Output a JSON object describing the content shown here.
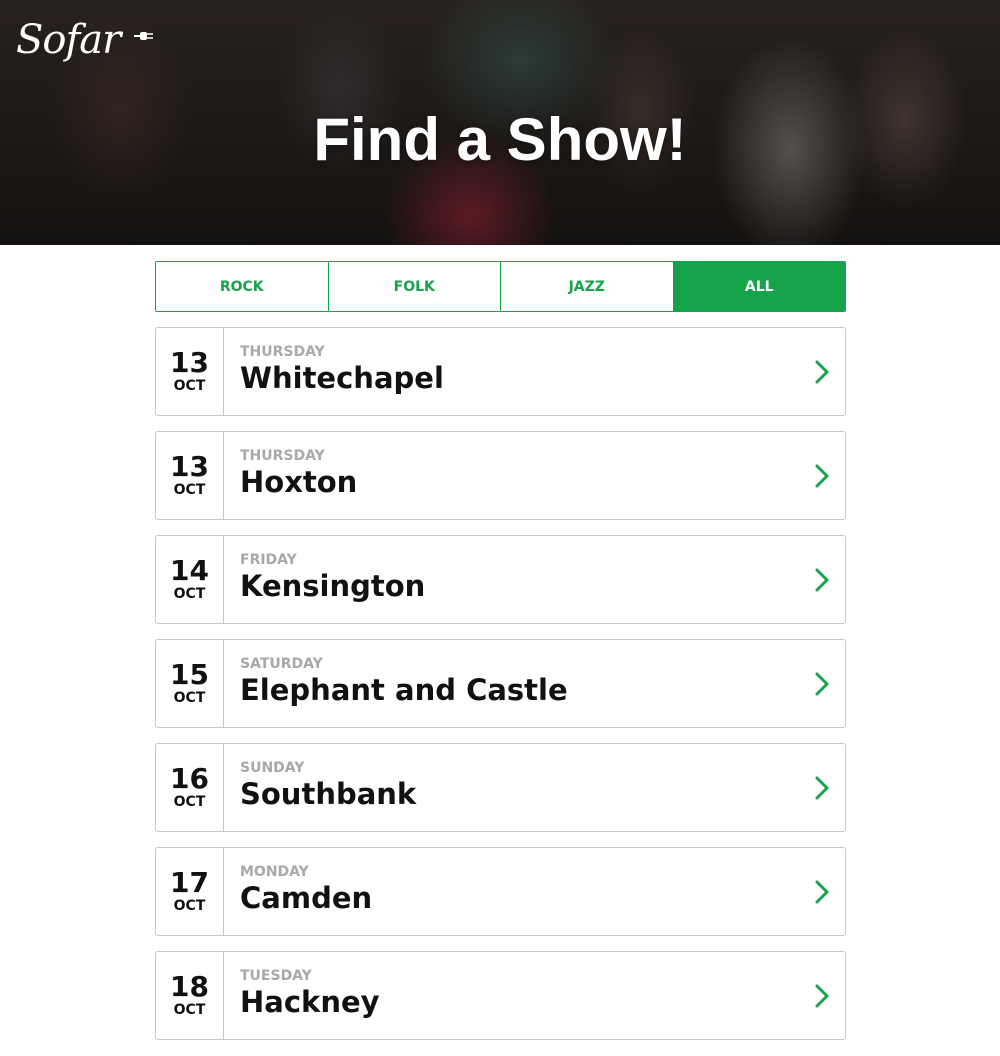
{
  "header": {
    "logo_text": "Sofar",
    "title": "Find a Show!"
  },
  "filters": {
    "tabs": [
      {
        "label": "ROCK",
        "active": false
      },
      {
        "label": "FOLK",
        "active": false
      },
      {
        "label": "JAZZ",
        "active": false
      },
      {
        "label": "ALL",
        "active": true
      }
    ]
  },
  "shows": [
    {
      "day": "13",
      "month": "OCT",
      "weekday": "THURSDAY",
      "venue": "Whitechapel"
    },
    {
      "day": "13",
      "month": "OCT",
      "weekday": "THURSDAY",
      "venue": "Hoxton"
    },
    {
      "day": "14",
      "month": "OCT",
      "weekday": "FRIDAY",
      "venue": "Kensington"
    },
    {
      "day": "15",
      "month": "OCT",
      "weekday": "SATURDAY",
      "venue": "Elephant and Castle"
    },
    {
      "day": "16",
      "month": "OCT",
      "weekday": "SUNDAY",
      "venue": "Southbank"
    },
    {
      "day": "17",
      "month": "OCT",
      "weekday": "MONDAY",
      "venue": "Camden"
    },
    {
      "day": "18",
      "month": "OCT",
      "weekday": "TUESDAY",
      "venue": "Hackney"
    }
  ],
  "icons": {
    "logo_plug": "plug-icon",
    "row_chevron": "chevron-right-icon"
  },
  "colors": {
    "accent": "#16a34a",
    "muted_text": "#a8a8a8",
    "border": "#c8c8c8"
  }
}
